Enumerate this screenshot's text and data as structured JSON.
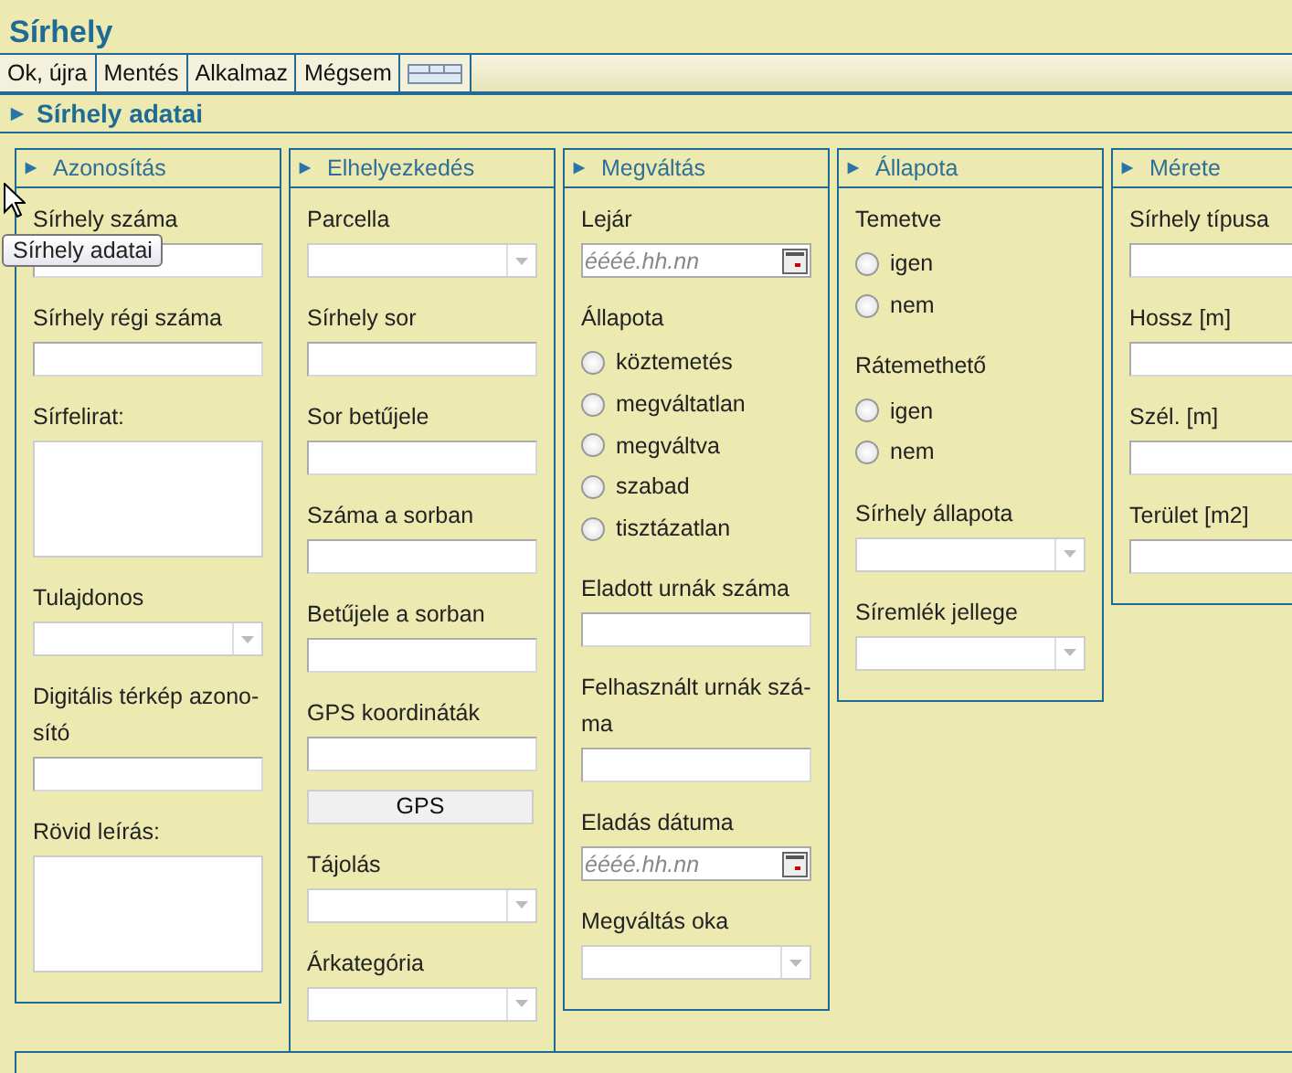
{
  "title": "Sírhely",
  "toolbar": [
    {
      "kind": "text",
      "label": "Ok, újra"
    },
    {
      "kind": "text",
      "label": "Mentés"
    },
    {
      "kind": "text",
      "label": "Alkalmaz"
    },
    {
      "kind": "text",
      "label": "Mégsem"
    },
    {
      "kind": "icon"
    }
  ],
  "section": {
    "title": "Sírhely adatai"
  },
  "panels": [
    {
      "title": "Azonosítás",
      "fields": [
        {
          "kind": "text",
          "label": "Sírhely száma"
        },
        {
          "kind": "text",
          "label": "Sírhely régi száma"
        },
        {
          "kind": "textarea",
          "label": "Sírfelirat:"
        },
        {
          "kind": "select",
          "label": "Tulajdonos"
        },
        {
          "kind": "text",
          "label": "Digitális térkép azono-\nsító"
        },
        {
          "kind": "textarea",
          "label": "Rövid leírás:"
        }
      ]
    },
    {
      "title": "Elhelyezkedés",
      "fields": [
        {
          "kind": "select",
          "label": "Parcella"
        },
        {
          "kind": "text",
          "label": "Sírhely sor"
        },
        {
          "kind": "text",
          "label": "Sor betűjele"
        },
        {
          "kind": "text",
          "label": "Száma a sorban"
        },
        {
          "kind": "text",
          "label": "Betűjele a sorban"
        },
        {
          "kind": "text",
          "label": "GPS koordináták"
        },
        {
          "kind": "button",
          "label": "GPS"
        },
        {
          "kind": "select",
          "label": "Tájolás"
        },
        {
          "kind": "select",
          "label": "Árkategória"
        }
      ]
    },
    {
      "title": "Megváltás",
      "fields": [
        {
          "kind": "date",
          "label": "Lejár",
          "placeholder": "éééé.hh.nn"
        },
        {
          "kind": "radios",
          "label": "Állapota",
          "options": [
            {
              "label": "köztemetés",
              "selected": false
            },
            {
              "label": "megváltatlan",
              "selected": false
            },
            {
              "label": "megváltva",
              "selected": false
            },
            {
              "label": "szabad",
              "selected": false
            },
            {
              "label": "tisztázatlan",
              "selected": false
            }
          ]
        },
        {
          "kind": "text",
          "label": "Eladott urnák száma"
        },
        {
          "kind": "text",
          "label": "Felhasznált urnák szá-\nma"
        },
        {
          "kind": "date",
          "label": "Eladás dátuma",
          "placeholder": "éééé.hh.nn"
        },
        {
          "kind": "select",
          "label": "Megváltás oka"
        }
      ]
    },
    {
      "title": "Állapota",
      "fields": [
        {
          "kind": "radios",
          "label": "Temetve",
          "options": [
            {
              "label": "igen",
              "selected": false
            },
            {
              "label": "nem",
              "selected": false
            }
          ]
        },
        {
          "kind": "radios",
          "label": "Rátemethető",
          "options": [
            {
              "label": "igen",
              "selected": false
            },
            {
              "label": "nem",
              "selected": false
            }
          ]
        },
        {
          "kind": "select",
          "label": "Sírhely állapota"
        },
        {
          "kind": "select",
          "label": "Síremlék jellege"
        }
      ]
    },
    {
      "title": "Mérete",
      "fields": [
        {
          "kind": "text",
          "label": "Sírhely típusa"
        },
        {
          "kind": "text",
          "label": "Hossz [m]"
        },
        {
          "kind": "text",
          "label": "Szél. [m]"
        },
        {
          "kind": "text",
          "label": "Terület [m2]"
        }
      ]
    }
  ],
  "tooltip": "Sírhely adatai"
}
